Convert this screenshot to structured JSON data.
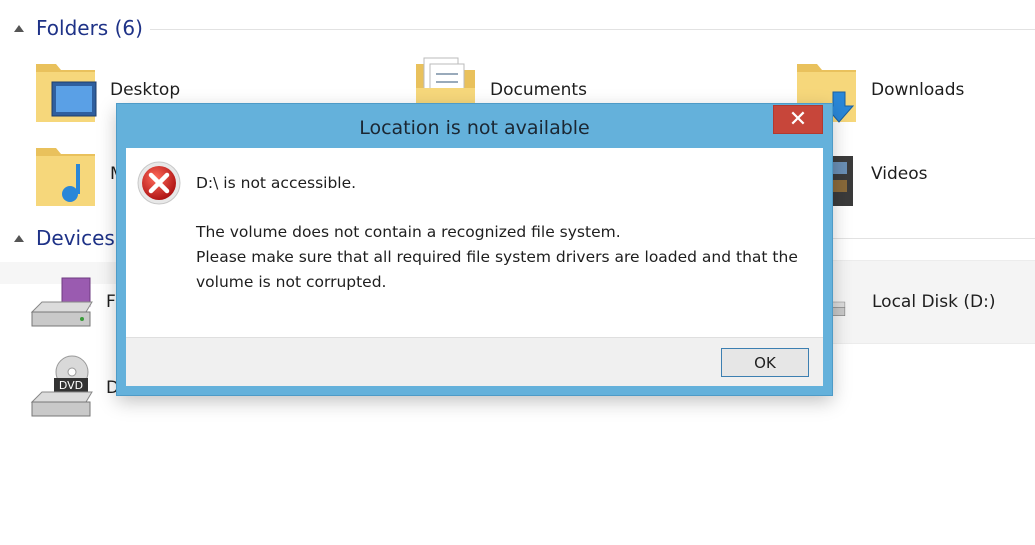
{
  "explorer": {
    "groups": [
      {
        "label": "Folders (6)"
      },
      {
        "label": "Devices"
      }
    ],
    "folders": [
      {
        "label": "Desktop",
        "icon": "desktop-folder-icon"
      },
      {
        "label": "Documents",
        "icon": "documents-folder-icon"
      },
      {
        "label": "Downloads",
        "icon": "downloads-folder-icon"
      },
      {
        "label": "M",
        "icon": "music-folder-icon"
      },
      {
        "label": "Videos",
        "icon": "videos-folder-icon"
      }
    ],
    "devices": [
      {
        "label": "F",
        "icon": "floppy-drive-icon"
      },
      {
        "label": "Local Disk (D:)",
        "icon": "hard-disk-icon"
      },
      {
        "label": "D",
        "icon": "dvd-drive-icon",
        "badge": "DVD"
      }
    ]
  },
  "dialog": {
    "title": "Location is not available",
    "close_label": "✕",
    "heading": "D:\\ is not accessible.",
    "line1": "The volume does not contain a recognized file system.",
    "line2": "Please make sure that all required file system drivers are loaded and that the",
    "line3": "volume is not corrupted.",
    "ok_label": "OK",
    "icon": "error-icon"
  },
  "colors": {
    "dialog_frame": "#64b1db",
    "close_button": "#c7463a",
    "group_header": "#1e3287"
  }
}
